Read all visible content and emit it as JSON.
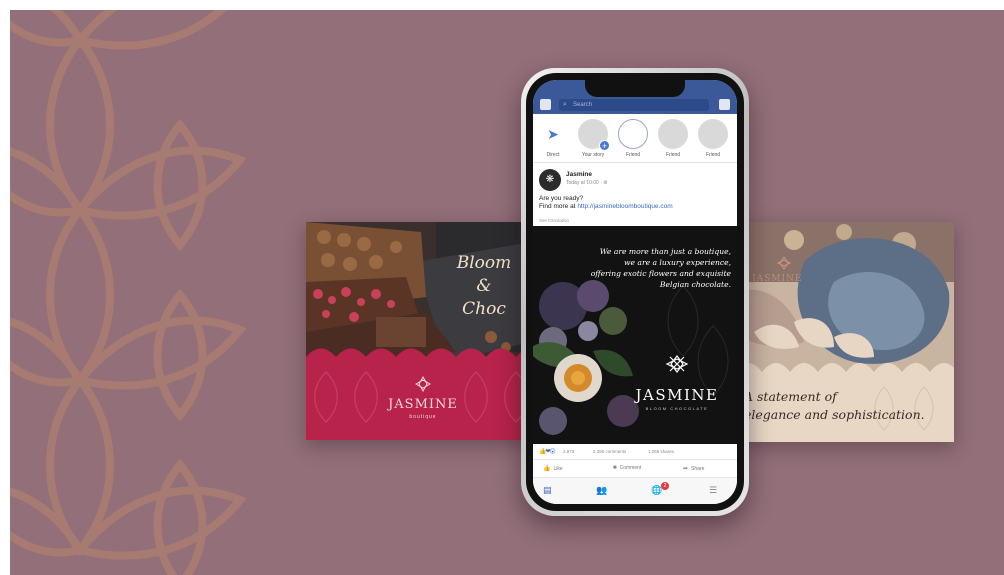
{
  "colors": {
    "background": "#926f79",
    "pattern": "#b07f73",
    "facebook_blue": "#3b5998",
    "left_card_red": "#b7234a",
    "right_card_cream": "#d9c6b2"
  },
  "left_card": {
    "tagline": [
      "Bloom",
      "&",
      "Choc"
    ],
    "brand": "JASMINE",
    "brand_sub": "boutique"
  },
  "right_card": {
    "brand": "JASMINE",
    "statement_lines": [
      "A statement of",
      "elegance and sophistication."
    ]
  },
  "phone": {
    "search_placeholder": "Search",
    "stories": [
      {
        "label": "Direct",
        "icon": "send-icon"
      },
      {
        "label": "Your story",
        "icon": "add-story-icon"
      },
      {
        "label": "Friend",
        "icon": ""
      },
      {
        "label": "Friend",
        "icon": ""
      },
      {
        "label": "Friend",
        "icon": ""
      }
    ],
    "post": {
      "author": "Jasmine",
      "time": "Today at 10:00 · ⚙",
      "text_line1": "Are you ready?",
      "text_line2_prefix": "Find more at",
      "text_link": "http://jasminebloomboutique.com",
      "translate_hint": "See translation",
      "quote_lines": [
        "We are more than just a boutique,",
        "we are a luxury experience,",
        "offering exotic flowers and exquisite",
        "Belgian chocolate."
      ],
      "brand": "JASMINE",
      "brand_sub": "BLOOM CHOCOLATE",
      "reactions_count": "2,873",
      "comments": "2,356 comments",
      "shares": "1,056 shares"
    },
    "actions": {
      "like": "Like",
      "comment": "Comment",
      "share": "Share"
    },
    "notifications_count": "2"
  }
}
